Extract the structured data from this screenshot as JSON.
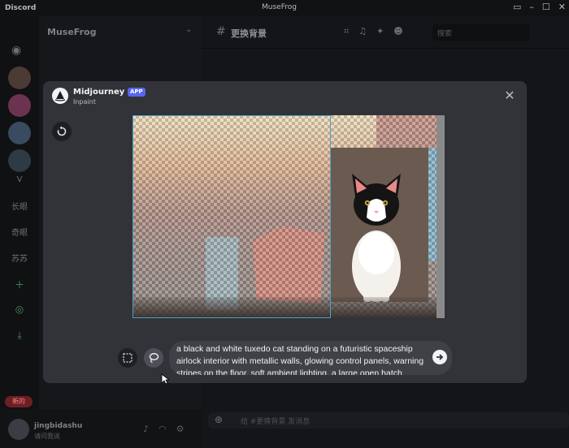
{
  "window": {
    "app_name": "Discord",
    "center_title": "MuseFrog"
  },
  "server": {
    "name": "MuseFrog"
  },
  "servers_rail": {
    "labels": [
      "V",
      "长眼",
      "奇眼",
      "苏苏"
    ]
  },
  "channel": {
    "name": "更换背景",
    "search_placeholder": "搜索"
  },
  "user": {
    "name": "jingbidashu",
    "status": "请问我说",
    "new_badge": "新的"
  },
  "message_input": {
    "placeholder": "给 #更换背景 发消息"
  },
  "modal": {
    "bot_name": "Midjourney Bot",
    "app_tag": "APP",
    "subtitle": "Inpaint",
    "prompt": "a black and white tuxedo cat standing on a futuristic spaceship airlock interior with metallic walls, glowing control panels, warning stripes on the floor, soft ambient lighting, a large open hatch"
  },
  "colors": {
    "accent": "#5865f2",
    "modal_bg": "#313338",
    "selection": "#4aa3c6"
  },
  "icons": [
    "discord-logo-icon",
    "reset-icon",
    "close-icon",
    "select-rect-icon",
    "lasso-icon",
    "submit-arrow-icon"
  ]
}
